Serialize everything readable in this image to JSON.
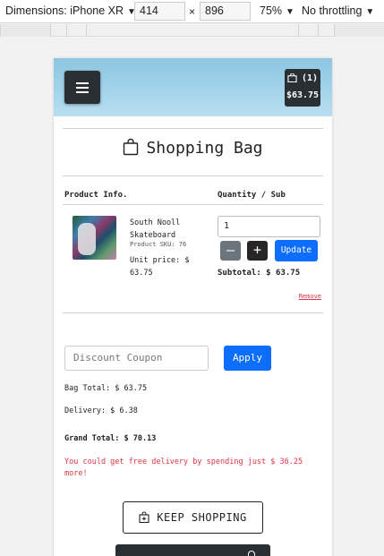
{
  "devtools": {
    "dimensions_label": "Dimensions: iPhone XR",
    "width": "414",
    "height": "896",
    "x_sep": "×",
    "zoom": "75%",
    "throttling": "No throttling"
  },
  "header": {
    "cart_count": "(1)",
    "cart_total": "$63.75"
  },
  "page_title": "Shopping Bag",
  "table": {
    "col_product": "Product Info.",
    "col_quantity": "Quantity / Sub"
  },
  "item": {
    "name": "South Nooll Skateboard",
    "sku": "Product SKU: 76",
    "unit_price": "Unit price: $ 63.75",
    "quantity": "1",
    "update_label": "Update",
    "subtotal": "Subtotal: $ 63.75",
    "remove_label": "Remove"
  },
  "coupon": {
    "placeholder": "Discount Coupon",
    "apply_label": "Apply"
  },
  "totals": {
    "bag_total": "Bag Total: $ 63.75",
    "delivery": "Delivery: $ 6.38",
    "grand_total": "Grand Total: $ 70.13",
    "free_delivery_msg": "You could get free delivery by spending just $ 36.25 more!"
  },
  "buttons": {
    "keep_shopping": "KEEP SHOPPING"
  },
  "colors": {
    "primary": "#0d6efd",
    "danger": "#dc3545",
    "dark": "#2a2f33",
    "header_gradient": "#9fd1ea"
  }
}
